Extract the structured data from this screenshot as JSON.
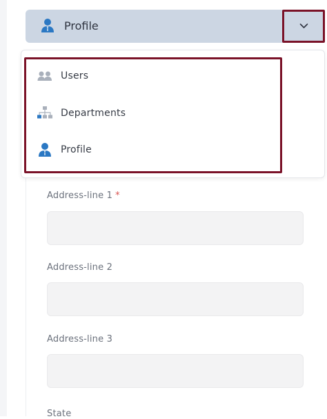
{
  "header": {
    "selected_label": "Profile",
    "icon": "user-icon"
  },
  "menu": {
    "items": [
      {
        "label": "Users",
        "icon": "users-icon"
      },
      {
        "label": "Departments",
        "icon": "hierarchy-icon"
      },
      {
        "label": "Profile",
        "icon": "user-icon"
      }
    ]
  },
  "form": {
    "address1": {
      "label": "Address-line 1",
      "required_mark": "*"
    },
    "address2": {
      "label": "Address-line 2"
    },
    "address3": {
      "label": "Address-line 3"
    },
    "state": {
      "label": "State"
    }
  },
  "colors": {
    "header_bg": "#ccd6e3",
    "highlight_border": "#7a1228",
    "icon_blue": "#2b78c3",
    "icon_gray": "#a9b0bb",
    "required": "#d9534f"
  }
}
